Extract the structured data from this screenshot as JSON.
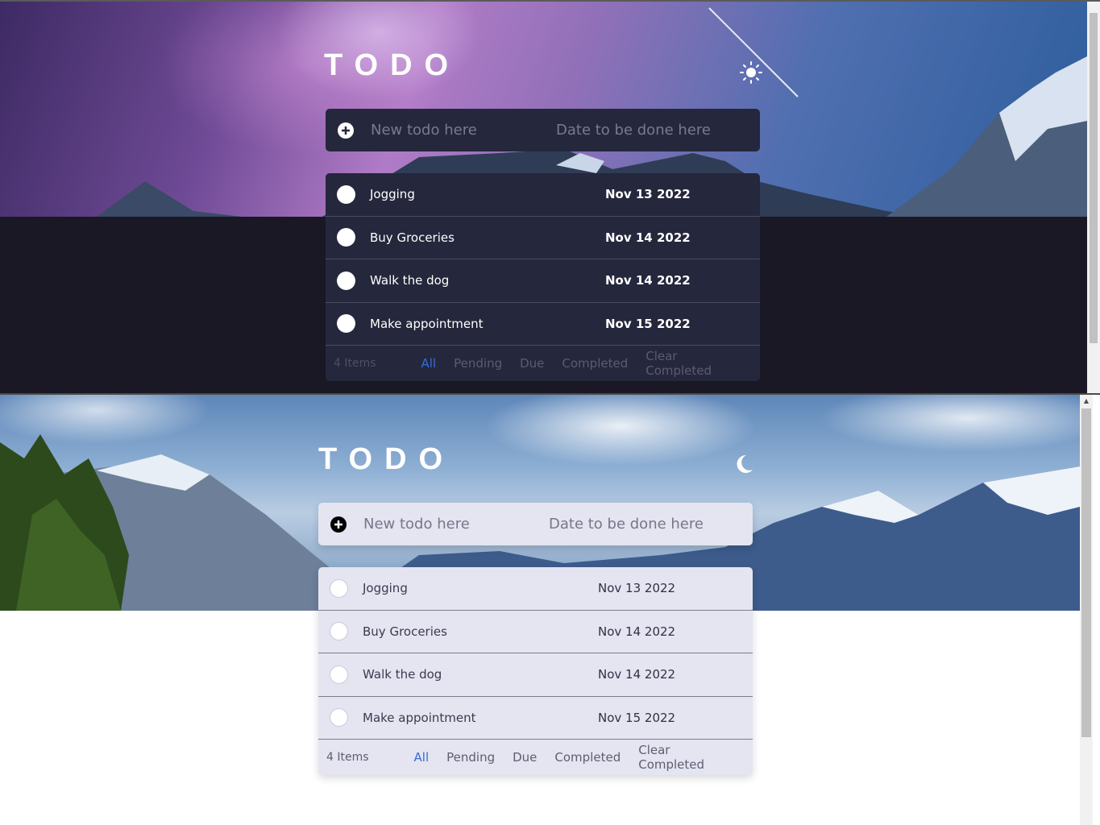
{
  "app": {
    "title": "TODO"
  },
  "new_todo": {
    "todo_placeholder": "New todo here",
    "date_placeholder": "Date to be done here"
  },
  "todos": [
    {
      "text": "Jogging",
      "date": "Nov 13 2022"
    },
    {
      "text": "Buy Groceries",
      "date": "Nov 14 2022"
    },
    {
      "text": "Walk the dog",
      "date": "Nov 14 2022"
    },
    {
      "text": "Make appointment",
      "date": "Nov 15 2022"
    }
  ],
  "footer": {
    "count": "4 Items",
    "filters": {
      "all": "All",
      "pending": "Pending",
      "due": "Due",
      "completed": "Completed"
    },
    "clear": "Clear Completed"
  },
  "themes": {
    "dark": {
      "toggle_icon": "sun-icon",
      "accent": "#3a6bd4",
      "card": "#25273c",
      "background": "#191824"
    },
    "light": {
      "toggle_icon": "moon-icon",
      "accent": "#3a6bd4",
      "card": "#e4e5f1",
      "background": "#ffffff"
    }
  }
}
